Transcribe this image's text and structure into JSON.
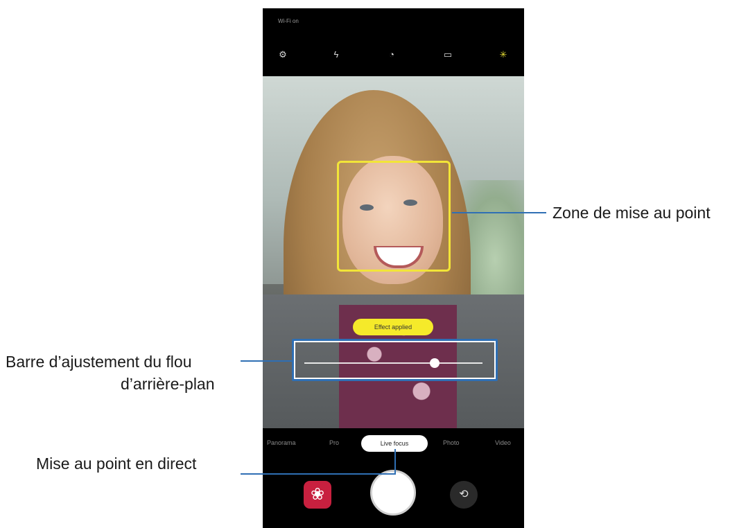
{
  "phone": {
    "status_text": "Wi-Fi on",
    "top_icons": [
      {
        "name": "settings-icon",
        "glyph": "⚙"
      },
      {
        "name": "flash-icon",
        "glyph": "ϟ"
      },
      {
        "name": "timer-icon",
        "glyph": "◔"
      },
      {
        "name": "ratio-icon",
        "glyph": "▭"
      },
      {
        "name": "filter-icon",
        "glyph": "✳"
      }
    ],
    "focus_badge": "Effect applied",
    "blur_slider_level": 0.73,
    "modes": [
      "Panorama",
      "Pro",
      "Live focus",
      "Photo",
      "Video"
    ],
    "active_mode": "Live focus",
    "effect_button_icon": "flower-icon",
    "switch_camera_icon": "switch-camera-icon",
    "accent_color": "#f2e538",
    "callout_color": "#2f6fb4"
  },
  "callouts": {
    "focus_zone": "Zone de mise au point",
    "blur_bar_line1": "Barre d’ajustement du flou",
    "blur_bar_line2": "d’arrière-plan",
    "live_focus": "Mise au point en direct"
  }
}
